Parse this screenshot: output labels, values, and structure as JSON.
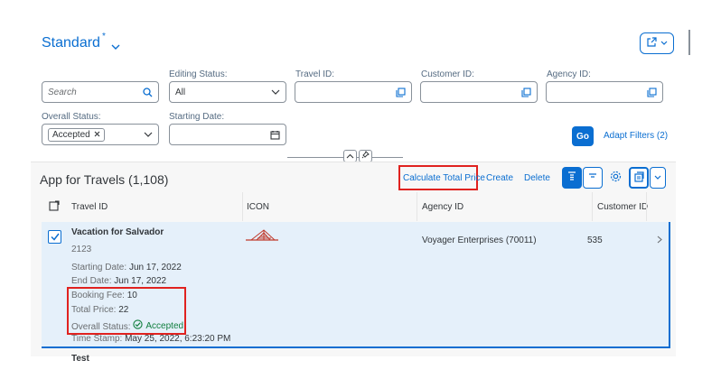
{
  "header": {
    "variant_name": "Standard",
    "variant_modified_marker": "*",
    "share_icon": "share-icon"
  },
  "filters": {
    "search": {
      "placeholder": "Search",
      "value": ""
    },
    "editing_status": {
      "label": "Editing Status:",
      "value": "All"
    },
    "travel_id": {
      "label": "Travel ID:",
      "value": ""
    },
    "customer_id": {
      "label": "Customer ID:",
      "value": ""
    },
    "agency_id": {
      "label": "Agency ID:",
      "value": ""
    },
    "overall_status": {
      "label": "Overall Status:",
      "tokens": [
        "Accepted"
      ]
    },
    "starting_date": {
      "label": "Starting Date:",
      "value": ""
    },
    "go_label": "Go",
    "adapt_label": "Adapt Filters (2)"
  },
  "table": {
    "title": "App for Travels (1,108)",
    "toolbar": {
      "calculate_label": "Calculate Total Price",
      "create_label": "Create",
      "delete_label": "Delete"
    },
    "columns": [
      "Travel ID",
      "ICON",
      "Agency ID",
      "Customer ID"
    ],
    "rows": [
      {
        "title": "Vacation for Salvador",
        "id": "2123",
        "selected": true,
        "attributes": [
          {
            "label": "Starting Date:",
            "value": "Jun 17, 2022"
          },
          {
            "label": "End Date:",
            "value": "Jun 17, 2022"
          },
          {
            "label": "Booking Fee:",
            "value": "10"
          },
          {
            "label": "Total Price:",
            "value": "22"
          },
          {
            "label": "Overall Status:",
            "value": "Accepted"
          },
          {
            "label": "Time Stamp:",
            "value": "May 25, 2022, 6:23:20 PM"
          }
        ],
        "agency": "Voyager Enterprises (70011)",
        "customer": "535"
      },
      {
        "title": "Test"
      }
    ]
  },
  "colors": {
    "accent": "#0a6ed1",
    "highlight": "#e0221f",
    "success": "#107e3e",
    "row_selected": "#e5f0fa"
  }
}
